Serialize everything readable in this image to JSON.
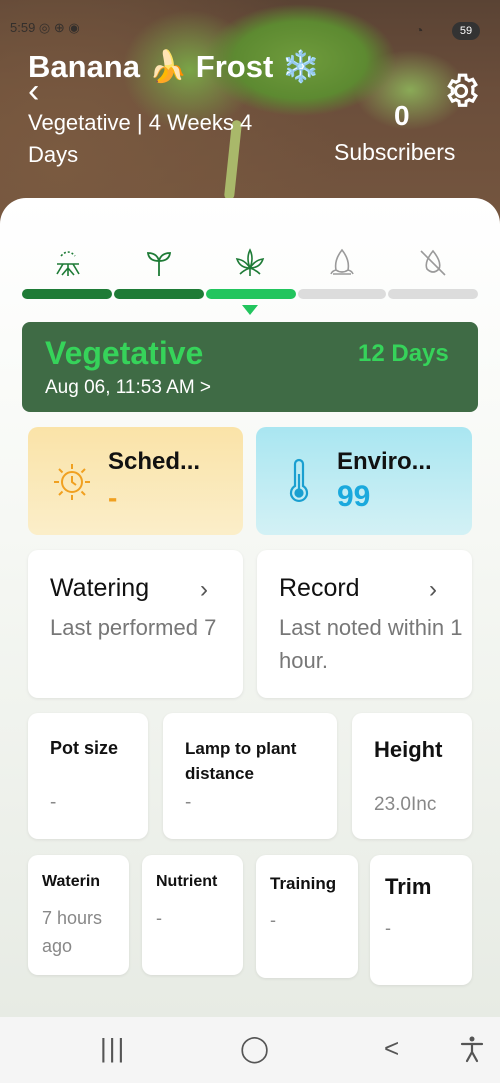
{
  "status": {
    "time_icons": "5:59 ◎ ⊕ ◉",
    "battery": "59"
  },
  "header": {
    "title": "Banana 🍌 Frost ❄️",
    "subtitle": "Vegetative | 4 Weeks 4 Days",
    "subscribers_count": "0",
    "subscribers_label": "Subscribers"
  },
  "stages": {
    "icons": [
      "roots-icon",
      "seedling-icon",
      "leaf-icon",
      "flower-icon",
      "drying-icon"
    ],
    "active_color": "#1e7b36",
    "current_color": "#22c55e",
    "inactive_color": "#dcdcdc"
  },
  "current_stage": {
    "name": "Vegetative",
    "days": "12 Days",
    "date": "Aug 06, 11:53 AM >"
  },
  "schedule": {
    "label": "Sched...",
    "value": "-"
  },
  "environment": {
    "label": "Enviro...",
    "value": "99"
  },
  "watering": {
    "label": "Watering",
    "body": "Last performed 7"
  },
  "record": {
    "label": "Record",
    "body": "Last noted within 1 hour."
  },
  "pot_size": {
    "label": "Pot size",
    "value": "-"
  },
  "lamp": {
    "label": "Lamp to plant distance",
    "value": "-"
  },
  "height": {
    "label": "Height",
    "value": "23.0Inc"
  },
  "small_cards": [
    {
      "label": "Waterin",
      "value": "7 hours ago"
    },
    {
      "label": "Nutrient",
      "value": "-"
    },
    {
      "label": "Training",
      "value": "-"
    },
    {
      "label": "Trim",
      "value": "-"
    }
  ],
  "nav": {
    "recents": "|||",
    "home": "◯",
    "back": "<"
  }
}
